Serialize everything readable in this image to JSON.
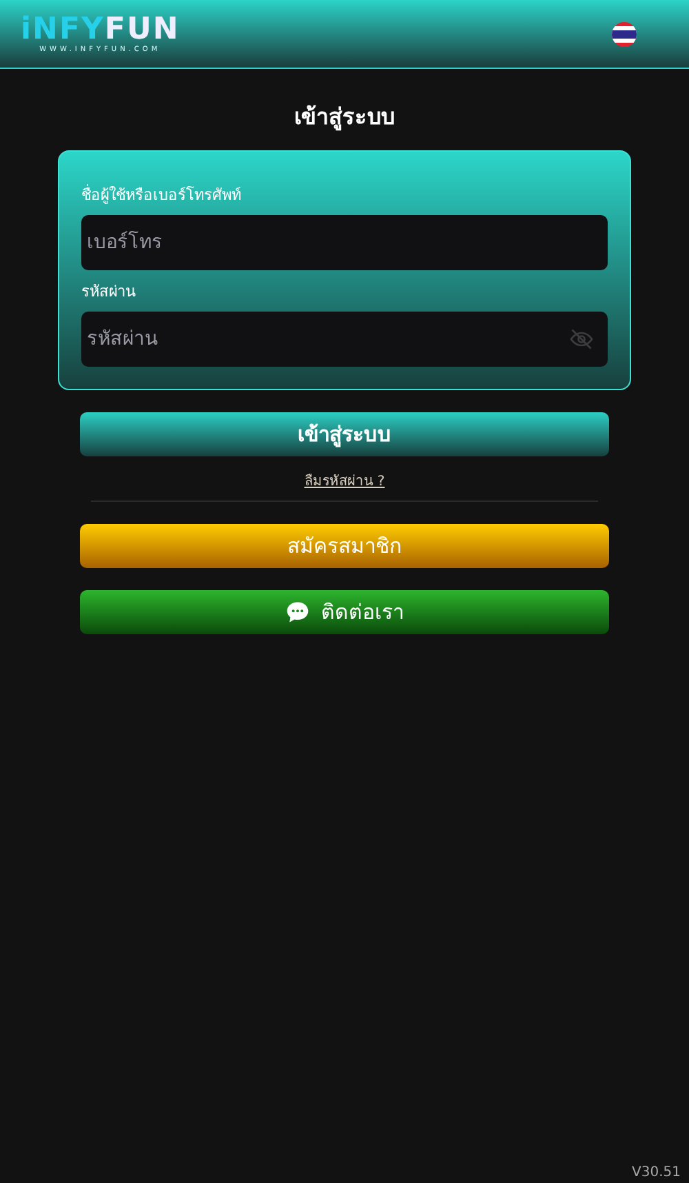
{
  "header": {
    "logo": {
      "part_1": "iNFY",
      "part_2": "FUN",
      "tagline": "WWW.INFYFUN.COM"
    }
  },
  "title": "เข้าสู่ระบบ",
  "form": {
    "fields": [
      {
        "label": "ชื่อผู้ใช้หรือเบอร์โทรศัพท์",
        "placeholder": "เบอร์โทร",
        "kind": "text"
      },
      {
        "label": "รหัสผ่าน",
        "placeholder": "รหัสผ่าน",
        "kind": "password"
      }
    ]
  },
  "login_button": "เข้าสู่ระบบ",
  "forgot_link": "ลืมรหัสผ่าน ?",
  "register_button": "สมัครสมาชิก",
  "contact_button": "ติดต่อเรา",
  "version": "V30.51"
}
